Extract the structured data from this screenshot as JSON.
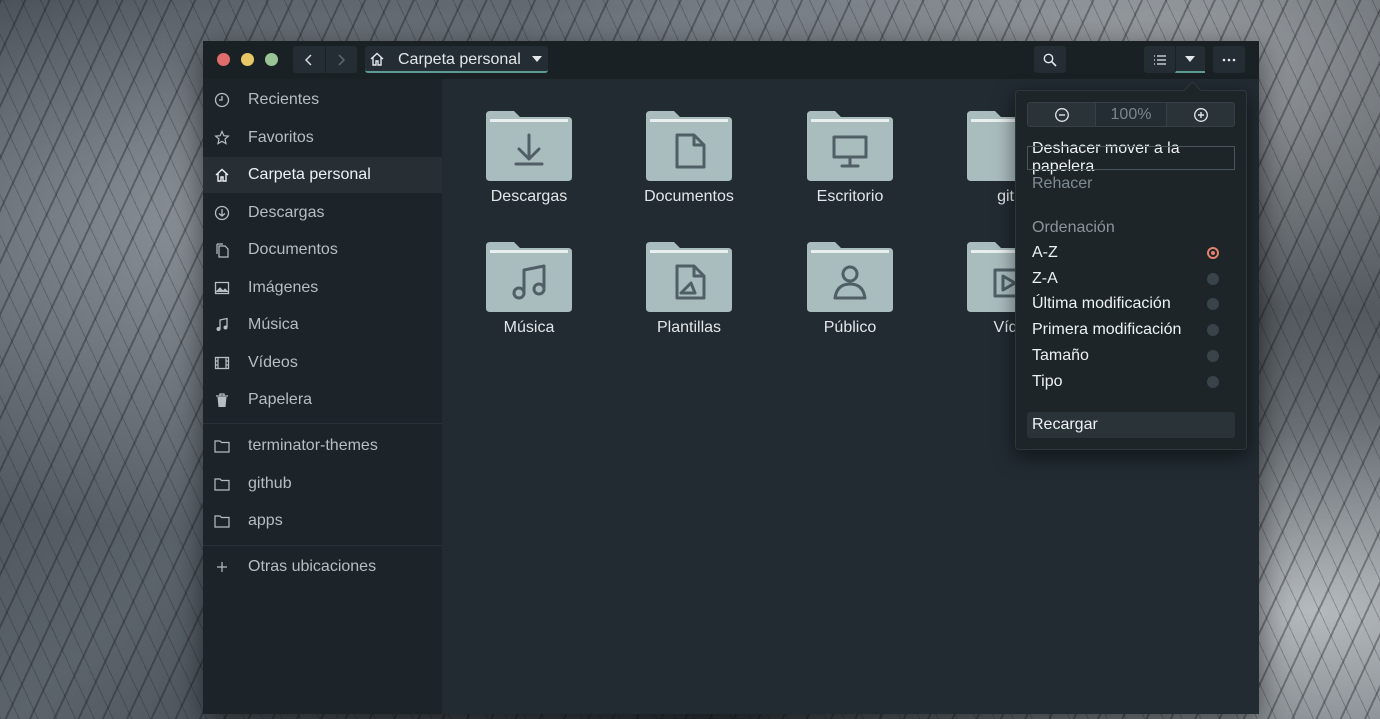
{
  "window": {
    "path_label": "Carpeta personal"
  },
  "sidebar": {
    "places": [
      {
        "label": "Recientes",
        "icon": "clock-icon"
      },
      {
        "label": "Favoritos",
        "icon": "star-icon"
      },
      {
        "label": "Carpeta personal",
        "icon": "home-icon",
        "active": true
      },
      {
        "label": "Descargas",
        "icon": "download-icon"
      },
      {
        "label": "Documentos",
        "icon": "document-icon"
      },
      {
        "label": "Imágenes",
        "icon": "image-icon"
      },
      {
        "label": "Música",
        "icon": "music-note-icon"
      },
      {
        "label": "Vídeos",
        "icon": "film-icon"
      },
      {
        "label": "Papelera",
        "icon": "trash-icon"
      }
    ],
    "bookmarks": [
      {
        "label": "terminator-themes",
        "icon": "folder-icon"
      },
      {
        "label": "github",
        "icon": "folder-icon"
      },
      {
        "label": "apps",
        "icon": "folder-icon"
      }
    ],
    "other_locations": {
      "label": "Otras ubicaciones",
      "icon": "plus-icon"
    }
  },
  "content": {
    "folders": [
      {
        "label": "Descargas",
        "icon": "download-icon"
      },
      {
        "label": "Documentos",
        "icon": "document-icon"
      },
      {
        "label": "Escritorio",
        "icon": "desktop-icon"
      },
      {
        "label": "gith",
        "icon": "folder-icon"
      },
      {
        "label": "Música",
        "icon": "music-note-icon"
      },
      {
        "label": "Plantillas",
        "icon": "template-icon"
      },
      {
        "label": "Público",
        "icon": "person-icon"
      },
      {
        "label": "Víde",
        "icon": "video-icon"
      }
    ]
  },
  "menu": {
    "zoom_level": "100%",
    "undo": "Deshacer mover a la papelera",
    "redo": "Rehacer",
    "sort_heading": "Ordenación",
    "sort_options": [
      {
        "label": "A-Z",
        "checked": true
      },
      {
        "label": "Z-A",
        "checked": false
      },
      {
        "label": "Última modificación",
        "checked": false
      },
      {
        "label": "Primera modificación",
        "checked": false
      },
      {
        "label": "Tamaño",
        "checked": false
      },
      {
        "label": "Tipo",
        "checked": false
      }
    ],
    "reload": "Recargar"
  },
  "colors": {
    "accent": "#5f9a94",
    "radio_checked": "#e4816d",
    "close": "#e06c6c",
    "minimize": "#e8c767",
    "maximize": "#9bc496",
    "folder": "#a9bcbe"
  }
}
